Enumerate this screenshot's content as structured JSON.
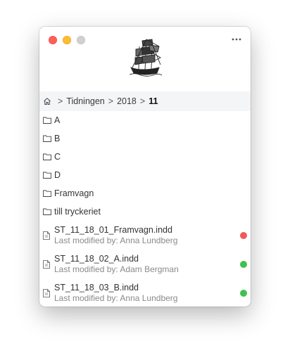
{
  "window": {
    "controls": [
      "close",
      "minimize",
      "zoom"
    ],
    "more_icon": "ellipsis-icon",
    "logo_icon": "ship-logo"
  },
  "breadcrumb": {
    "home_icon": "home-icon",
    "separator": ">",
    "items": [
      "Tidningen",
      "2018"
    ],
    "current": "11"
  },
  "folders": [
    {
      "name": "A"
    },
    {
      "name": "B"
    },
    {
      "name": "C"
    },
    {
      "name": "D"
    },
    {
      "name": "Framvagn"
    },
    {
      "name": "till tryckeriet"
    }
  ],
  "files": [
    {
      "name": "ST_11_18_01_Framvagn.indd",
      "modified": "Last modified by: Anna Lundberg",
      "status": "red",
      "status_color": "#f0585a"
    },
    {
      "name": "ST_11_18_02_A.indd",
      "modified": "Last modified by: Adam Bergman",
      "status": "green",
      "status_color": "#3ec14f"
    },
    {
      "name": "ST_11_18_03_B.indd",
      "modified": "Last modified by: Anna Lundberg",
      "status": "green",
      "status_color": "#3ec14f"
    }
  ]
}
